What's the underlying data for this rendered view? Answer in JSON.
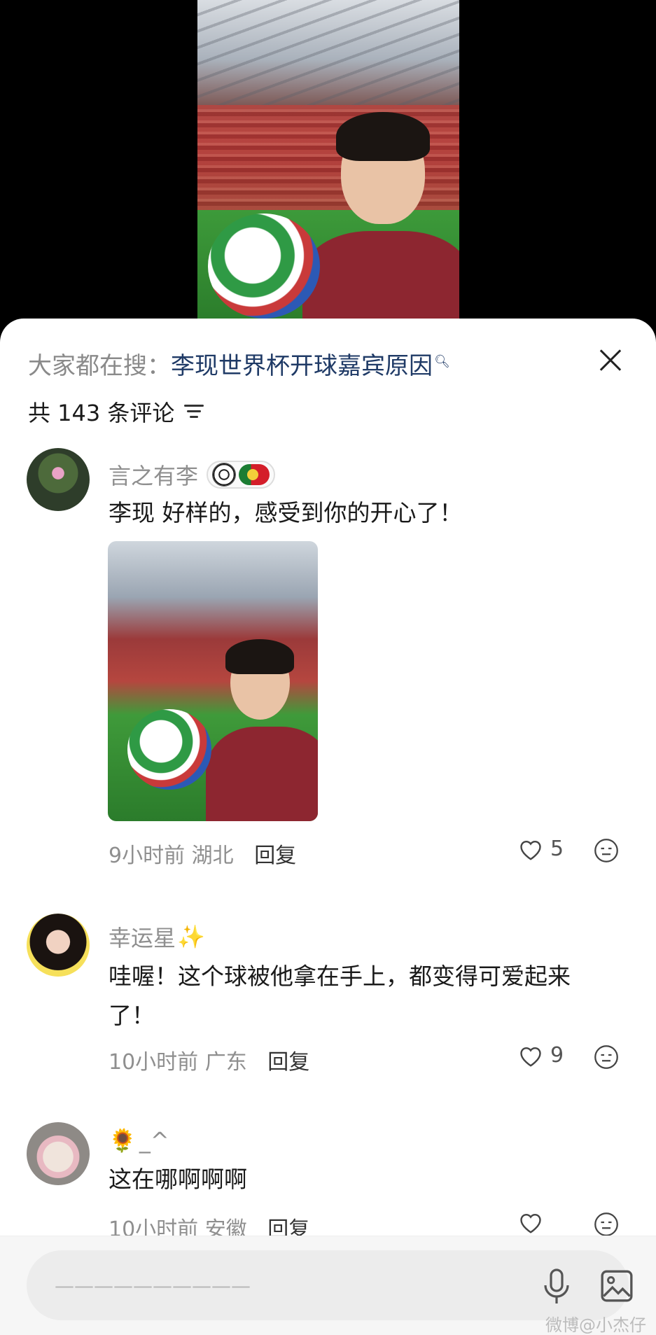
{
  "search_hint": {
    "prefix": "大家都在搜：",
    "query": "李现世界杯开球嘉宾原因",
    "icon": "search-icon"
  },
  "header": {
    "count_label": "共 143 条评论",
    "close_icon": "close-icon",
    "sort_icon": "sort-icon"
  },
  "comments": [
    {
      "username": "言之有李",
      "badge_icons": [
        "soccer-ball-icon",
        "portugal-flag-icon"
      ],
      "text": "李现 好样的，感受到你的开心了！",
      "has_image": true,
      "time": "9小时前",
      "location": "湖北",
      "reply_label": "回复",
      "likes": "5"
    },
    {
      "username": "幸运星",
      "username_icon": "✨",
      "text": "哇喔！这个球被他拿在手上，都变得可爱起来了！",
      "time": "10小时前",
      "location": "广东",
      "reply_label": "回复",
      "likes": "9"
    },
    {
      "username_icon": "🌻",
      "username": "_^",
      "text": "这在哪啊啊啊",
      "time": "10小时前",
      "location": "安徽",
      "reply_label": "回复",
      "likes": ""
    }
  ],
  "input_bar": {
    "placeholder": "——————————",
    "mic_icon": "microphone-icon",
    "image_icon": "image-icon"
  },
  "watermark": "微博@小杰仔",
  "colors": {
    "query_link": "#1f3a66",
    "muted_text": "#8f8f8f",
    "body_text": "#1a1a1a"
  }
}
